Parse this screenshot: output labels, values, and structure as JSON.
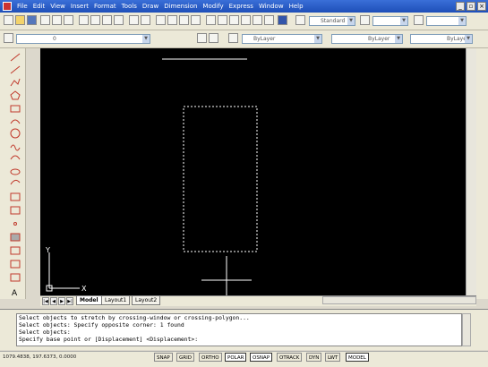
{
  "menu": [
    "File",
    "Edit",
    "View",
    "Insert",
    "Format",
    "Tools",
    "Draw",
    "Dimension",
    "Modify",
    "Express",
    "Window",
    "Help"
  ],
  "toolbar": {
    "text_style": "Standard",
    "layer_control": "0",
    "color_control": "ByLayer",
    "linetype_control": "ByLayer",
    "lineweight_control": "ByLayer"
  },
  "ucs": {
    "x_label": "X",
    "y_label": "Y"
  },
  "tabs": [
    {
      "label": "Model",
      "active": true
    },
    {
      "label": "Layout1",
      "active": false
    },
    {
      "label": "Layout2",
      "active": false
    }
  ],
  "command": {
    "lines": [
      "Select objects to stretch by crossing-window or crossing-polygon...",
      "Select objects: Specify opposite corner: 1 found",
      "Select objects:",
      "Specify base point or [Displacement] <Displacement>:"
    ]
  },
  "status": {
    "coords": "1079.4838, 197.6373, 0.0000",
    "buttons": [
      {
        "label": "SNAP",
        "on": false
      },
      {
        "label": "GRID",
        "on": false
      },
      {
        "label": "ORTHO",
        "on": false
      },
      {
        "label": "POLAR",
        "on": true
      },
      {
        "label": "OSNAP",
        "on": true
      },
      {
        "label": "OTRACK",
        "on": false
      },
      {
        "label": "DYN",
        "on": false
      },
      {
        "label": "LWT",
        "on": false
      },
      {
        "label": "MODEL",
        "on": true
      }
    ]
  },
  "colors": {
    "canvas": "#000000",
    "title_bar": "#2a5ccc",
    "drawing_lines": "#ffffff"
  }
}
